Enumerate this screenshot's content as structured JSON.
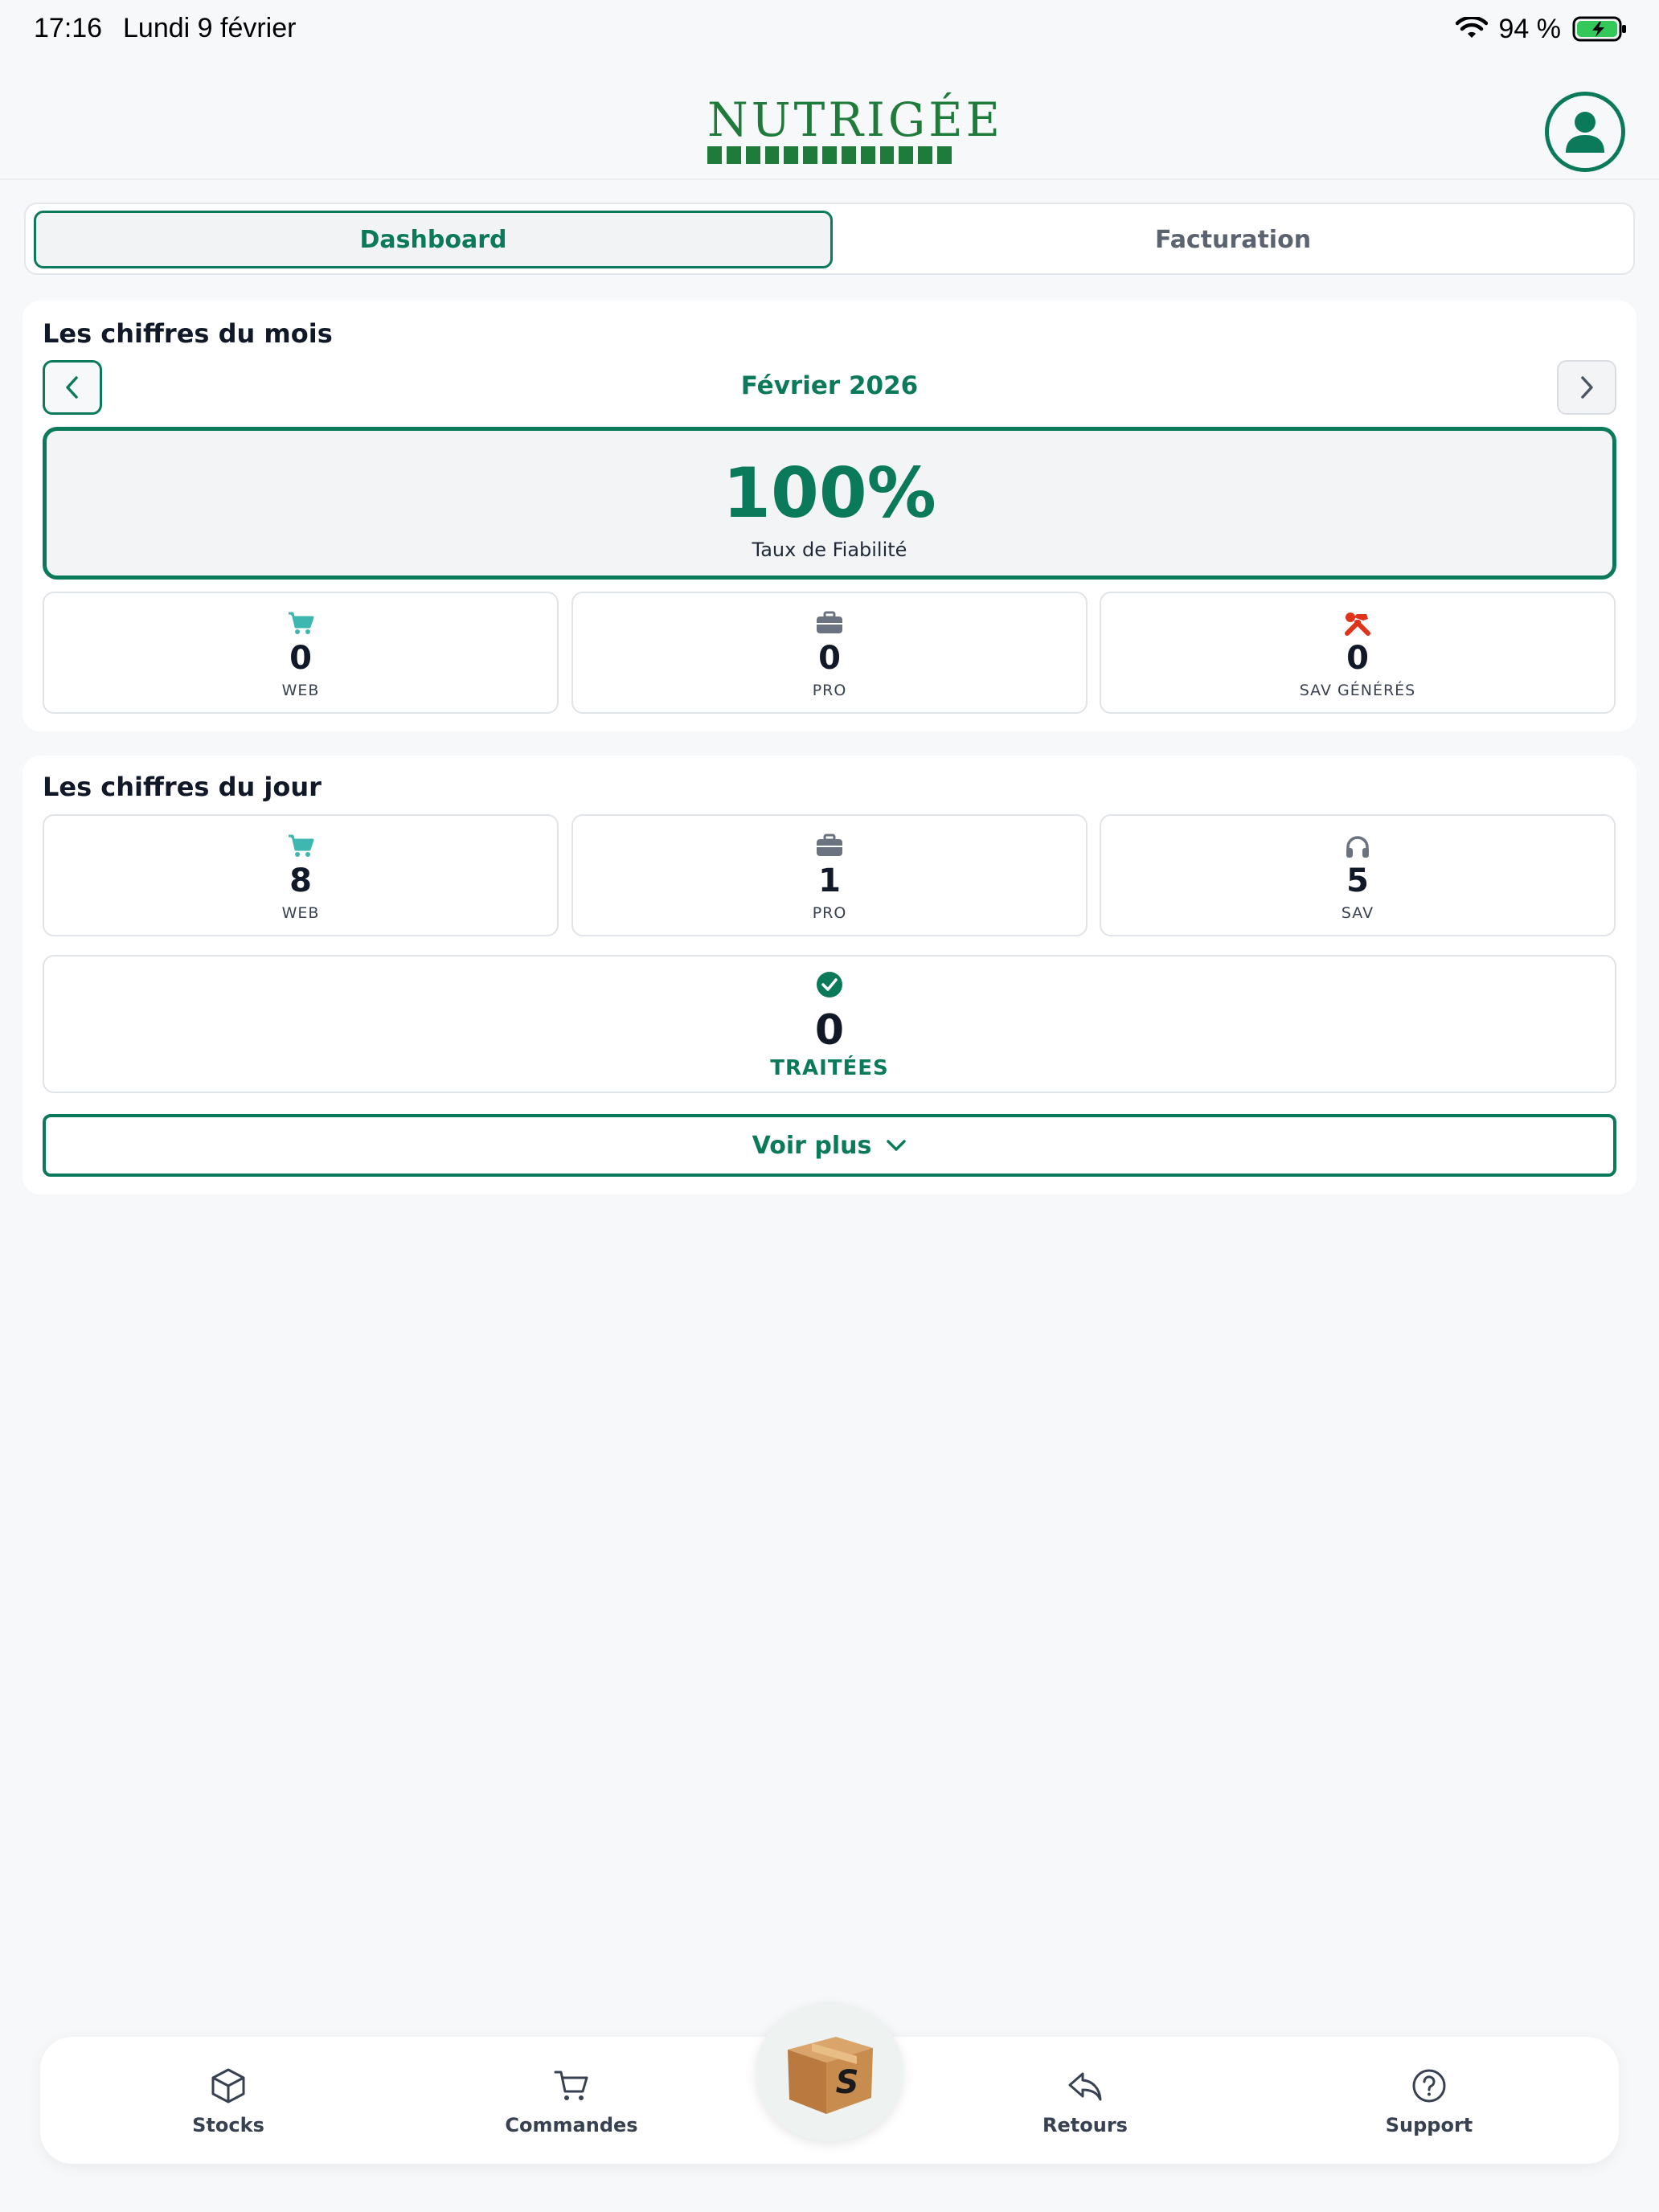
{
  "status_bar": {
    "time": "17:16",
    "date": "Lundi 9 février",
    "battery": "94 %"
  },
  "header": {
    "logo_text": "NUTRIGÉE"
  },
  "tabs": [
    {
      "label": "Dashboard",
      "active": true
    },
    {
      "label": "Facturation",
      "active": false
    }
  ],
  "month_section": {
    "title": "Les chiffres du mois",
    "period": "Février 2026",
    "reliability": {
      "value": "100%",
      "label": "Taux de Fiabilité"
    },
    "stats": [
      {
        "value": "0",
        "label": "WEB",
        "icon": "cart-icon",
        "color": "#3db7b0"
      },
      {
        "value": "0",
        "label": "PRO",
        "icon": "briefcase-icon",
        "color": "#6b7280"
      },
      {
        "value": "0",
        "label": "SAV GÉNÉRÉS",
        "icon": "tools-icon",
        "color": "#e0331b"
      }
    ]
  },
  "day_section": {
    "title": "Les chiffres du jour",
    "stats": [
      {
        "value": "8",
        "label": "WEB",
        "icon": "cart-icon",
        "color": "#3db7b0"
      },
      {
        "value": "1",
        "label": "PRO",
        "icon": "briefcase-icon",
        "color": "#6b7280"
      },
      {
        "value": "5",
        "label": "SAV",
        "icon": "headphones-icon",
        "color": "#6b7280"
      }
    ],
    "processed": {
      "value": "0",
      "label": "TRAITÉES",
      "icon": "check-circle-icon"
    },
    "more_button": "Voir plus"
  },
  "bottom_nav": [
    {
      "label": "Stocks",
      "icon": "box-icon"
    },
    {
      "label": "Commandes",
      "icon": "cart-icon"
    },
    {
      "label": "Retours",
      "icon": "reply-icon"
    },
    {
      "label": "Support",
      "icon": "help-icon"
    }
  ],
  "center_button": {
    "icon": "package-icon",
    "glyph": "S"
  },
  "colors": {
    "accent": "#0b7a5a",
    "brand": "#1e7b3a",
    "danger": "#e0331b",
    "teal": "#3db7b0"
  }
}
